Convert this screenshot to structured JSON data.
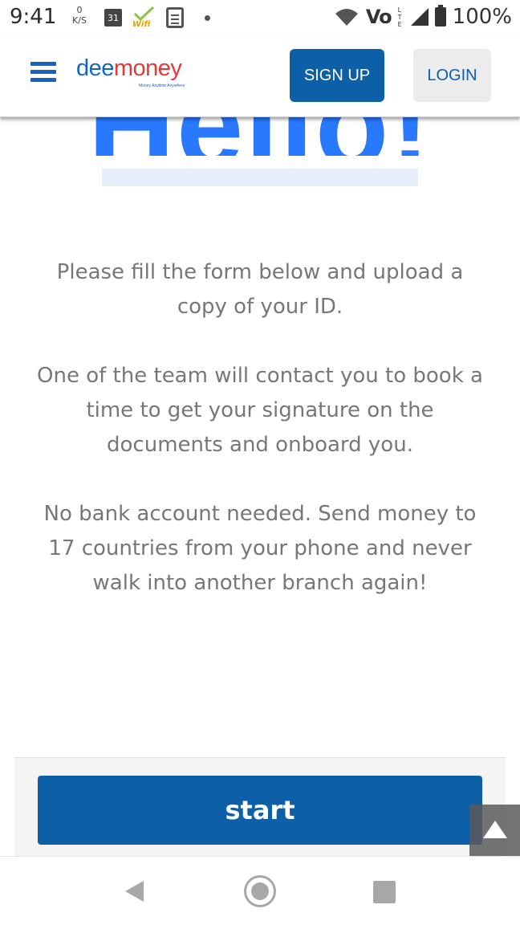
{
  "status_bar": {
    "time": "9:41",
    "net_speed_value": "0",
    "net_speed_unit": "K/S",
    "calendar_day": "31",
    "wifi_app_label": "Wifi",
    "network_label": "Vo",
    "lte_label": "LTE",
    "battery_percent": "100%"
  },
  "header": {
    "logo_dee": "dee",
    "logo_money": "money",
    "logo_tagline": "Money Anytime Anywhere",
    "signup_label": "SIGN UP",
    "login_label": "LOGIN"
  },
  "main": {
    "hero_title": "Hello!",
    "paragraphs": [
      "Please fill the form below and upload a copy of your ID.",
      "One of the team will contact you to book a time to get your signature on the documents and onboard you.",
      "No bank account needed. Send money to 17 countries from your phone and never walk into another branch again!"
    ],
    "start_label": "start"
  },
  "colors": {
    "brand_blue": "#0d5fa8",
    "hero_blue": "#2979ff",
    "logo_red": "#e53935",
    "body_text": "#777777"
  },
  "icons": {
    "menu": "hamburger-icon",
    "scroll_top": "arrow-up-icon",
    "nav_back": "back-triangle-icon",
    "nav_home": "home-circle-icon",
    "nav_recent": "recent-apps-square-icon"
  }
}
